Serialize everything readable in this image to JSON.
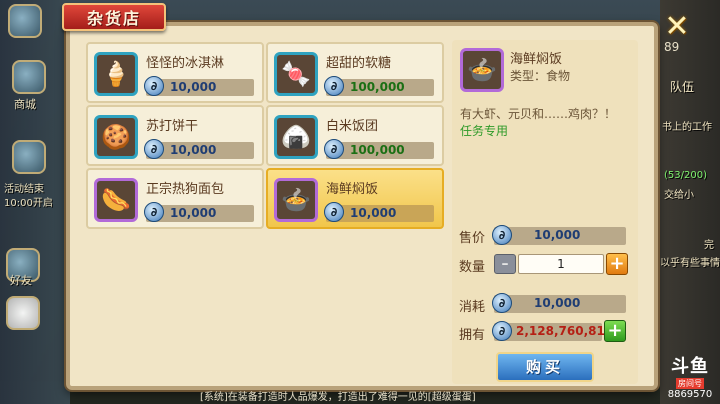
{
  "shop": {
    "title": "杂货店",
    "close": "✕",
    "corner_number": "89",
    "items": [
      {
        "name": "怪怪的冰淇淋",
        "price": "10,000",
        "icon": "ice-cream-icon",
        "glyph": "🍦",
        "rarity": "blue"
      },
      {
        "name": "超甜的软糖",
        "price": "100,000",
        "icon": "candy-icon",
        "glyph": "🍬",
        "rarity": "blue",
        "price_color": "green"
      },
      {
        "name": "苏打饼干",
        "price": "10,000",
        "icon": "cracker-icon",
        "glyph": "🍪",
        "rarity": "blue"
      },
      {
        "name": "白米饭团",
        "price": "100,000",
        "icon": "rice-ball-icon",
        "glyph": "🍙",
        "rarity": "blue",
        "price_color": "green"
      },
      {
        "name": "正宗热狗面包",
        "price": "10,000",
        "icon": "hotdog-icon",
        "glyph": "🌭",
        "rarity": "purple"
      },
      {
        "name": "海鲜焖饭",
        "price": "10,000",
        "icon": "seafood-rice-icon",
        "glyph": "🍲",
        "rarity": "purple",
        "selected": true
      }
    ]
  },
  "detail": {
    "name": "海鲜焖饭",
    "type": "类型：食物",
    "description": "有大虾、元贝和……鸡肉？！",
    "tag": "任务专用",
    "price_label": "售价",
    "price": "10,000",
    "qty_label": "数量",
    "qty": "1",
    "cost_label": "消耗",
    "cost": "10,000",
    "owned_label": "拥有",
    "owned": "2,128,760,817",
    "buy": "购买"
  },
  "background": {
    "left": [
      "好友",
      "活动结束",
      "10:00开启",
      "商城"
    ],
    "right": [
      "队伍",
      "书上的工作",
      "(53/200)",
      "交给小",
      "完",
      "以乎有些事情"
    ],
    "ticker": "[系统]在装备打造时人品爆发，打造出了难得一见的[超级蛋蛋]"
  },
  "watermark": {
    "logo": "斗鱼",
    "room_label": "房间号",
    "room": "8869570"
  }
}
